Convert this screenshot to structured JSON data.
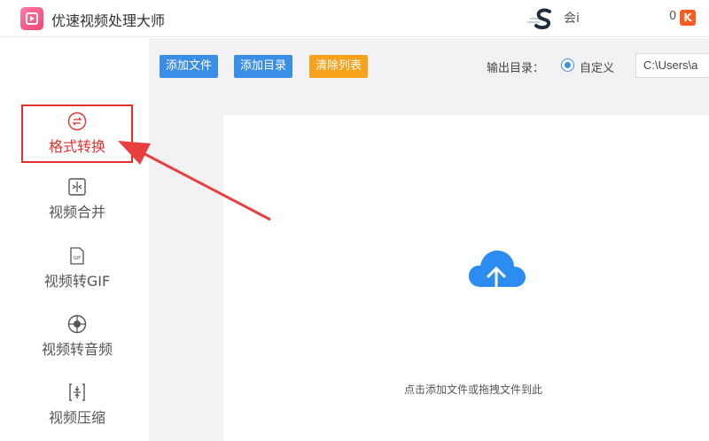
{
  "app": {
    "title": "优速视频处理大师",
    "user_name": "会i",
    "coin_count": "0",
    "coin_symbol": "K"
  },
  "sidebar": {
    "items": [
      {
        "label": "格式转换",
        "icon": "convert-icon",
        "active": true
      },
      {
        "label": "视频合并",
        "icon": "merge-icon"
      },
      {
        "label": "视频转GIF",
        "icon": "gif-icon"
      },
      {
        "label": "视频转音频",
        "icon": "audio-icon"
      },
      {
        "label": "视频压缩",
        "icon": "compress-icon"
      }
    ]
  },
  "toolbar": {
    "add_file": "添加文件",
    "add_dir": "添加目录",
    "clear_list": "清除列表",
    "output_label": "输出目录：",
    "custom_option": "自定义",
    "output_path": "C:\\Users\\a"
  },
  "dropzone": {
    "hint": "点击添加文件或拖拽文件到此"
  },
  "colors": {
    "primary": "#3a8ee6",
    "orange": "#f7a21b",
    "highlight": "#e5302c",
    "brand": "#f2456f"
  }
}
